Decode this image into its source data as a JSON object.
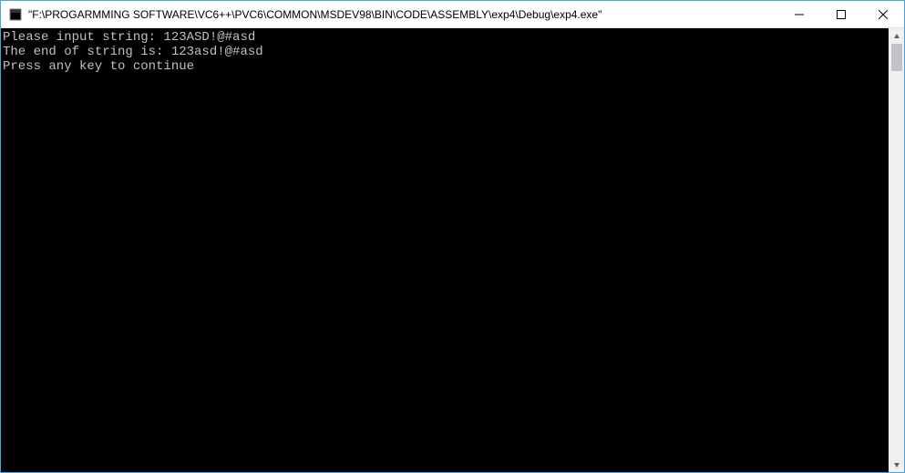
{
  "window": {
    "title": "\"F:\\PROGARMMING SOFTWARE\\VC6++\\PVC6\\COMMON\\MSDEV98\\BIN\\CODE\\ASSEMBLY\\exp4\\Debug\\exp4.exe\""
  },
  "console": {
    "lines": [
      "Please input string: 123ASD!@#asd",
      "The end of string is: 123asd!@#asd",
      "Press any key to continue"
    ]
  }
}
